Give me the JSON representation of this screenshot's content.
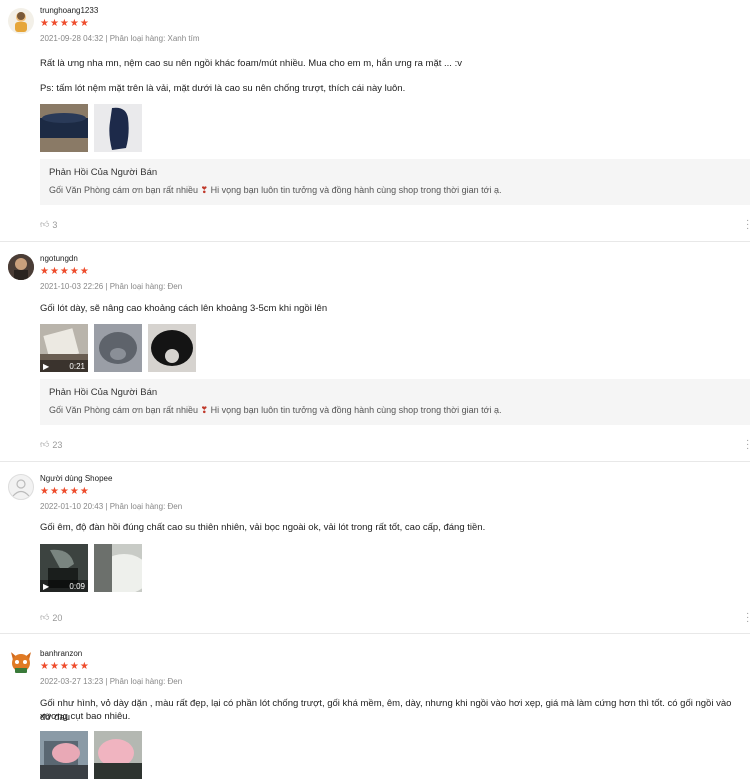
{
  "reviews": [
    {
      "username": "trunghoang1233",
      "stars": "★★★★★",
      "meta": "2021-09-28 04:32 | Phân loại hàng: Xanh tím",
      "text": [
        "Rất là ưng nha mn, nệm cao su nên ngồi khác foam/mút nhiều. Mua cho em m, hắn ưng ra mặt ... :v",
        "Ps: tấm lót nệm mặt trên là vải, mặt dưới là cao su nên chống trượt, thích cái này luôn."
      ],
      "reply_title": "Phản Hồi Của Người Bán",
      "reply_body_pre": "Gối Văn Phòng cám ơn bạn rất nhiều",
      "reply_body_post": "Hi vọng bạn luôn tin tưởng và đồng hành cùng shop trong thời gian tới ạ.",
      "likes": "3"
    },
    {
      "username": "ngotungdn",
      "stars": "★★★★★",
      "meta": "2021-10-03 22:26 | Phân loại hàng: Đen",
      "text": [
        "Gối lót dày, sẽ nâng cao khoảng cách lên khoảng 3-5cm khi ngồi lên"
      ],
      "video_duration": "0:21",
      "reply_title": "Phản Hồi Của Người Bán",
      "reply_body_pre": "Gối Văn Phòng cám ơn bạn rất nhiều",
      "reply_body_post": "Hi vọng bạn luôn tin tưởng và đồng hành cùng shop trong thời gian tới ạ.",
      "likes": "23"
    },
    {
      "username": "Người dùng Shopee",
      "stars": "★★★★★",
      "meta": "2022-01-10 20:43 | Phân loại hàng: Đen",
      "text": [
        "Gối êm,  độ đàn hồi đúng chất cao su thiên nhiên, vải bọc ngoài ok, vải lót trong rất tốt, cao cấp, đáng tiền."
      ],
      "video_duration": "0:09",
      "likes": "20"
    },
    {
      "username": "banhranzon",
      "stars": "★★★★★",
      "meta": "2022-03-27 13:23 | Phân loại hàng: Đen",
      "text": [
        "Gối như hình, vỏ dày dặn , màu rất đẹp, lại có phần lót chống trượt, gối khá mềm, êm, dày, nhưng khi ngồi vào hơi xẹp, giá mà làm cứng hơn thì tốt. có gối ngồi vào đỡ đau",
        "xương cụt bao nhiêu."
      ]
    }
  ],
  "colors": {
    "star": "#ee4d2d",
    "reply_bg": "#f5f5f5"
  },
  "icons": [
    "avatar",
    "thumb-up-icon",
    "more-icon",
    "video-icon",
    "heart-icon"
  ]
}
